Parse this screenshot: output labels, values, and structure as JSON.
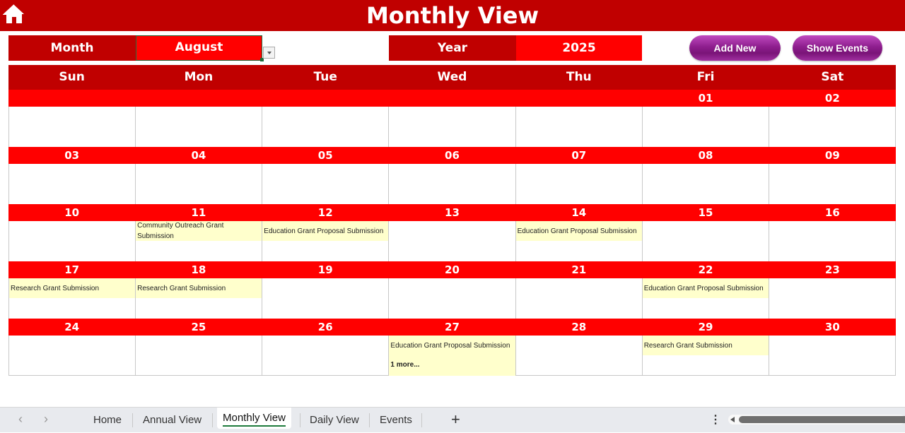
{
  "header": {
    "title": "Monthly View",
    "home_icon": "home-icon"
  },
  "controls": {
    "month_label": "Month",
    "month_value": "August",
    "year_label": "Year",
    "year_value": "2025",
    "add_new_label": "Add New",
    "show_events_label": "Show Events"
  },
  "calendar": {
    "days_of_week": [
      "Sun",
      "Mon",
      "Tue",
      "Wed",
      "Thu",
      "Fri",
      "Sat"
    ],
    "weeks": [
      {
        "dates": [
          "",
          "",
          "",
          "",
          "",
          "01",
          "02"
        ],
        "events": [
          "",
          "",
          "",
          "",
          "",
          "",
          ""
        ],
        "more": [
          "",
          "",
          "",
          "",
          "",
          "",
          ""
        ]
      },
      {
        "dates": [
          "03",
          "04",
          "05",
          "06",
          "07",
          "08",
          "09"
        ],
        "events": [
          "",
          "",
          "",
          "",
          "",
          "",
          ""
        ],
        "more": [
          "",
          "",
          "",
          "",
          "",
          "",
          ""
        ]
      },
      {
        "dates": [
          "10",
          "11",
          "12",
          "13",
          "14",
          "15",
          "16"
        ],
        "events": [
          "",
          "Community Outreach Grant Submission",
          "Education Grant Proposal Submission",
          "",
          "Education Grant Proposal Submission",
          "",
          ""
        ],
        "more": [
          "",
          "",
          "",
          "",
          "",
          "",
          ""
        ]
      },
      {
        "dates": [
          "17",
          "18",
          "19",
          "20",
          "21",
          "22",
          "23"
        ],
        "events": [
          "Research Grant Submission",
          "Research Grant Submission",
          "",
          "",
          "",
          "Education Grant Proposal Submission",
          ""
        ],
        "more": [
          "",
          "",
          "",
          "",
          "",
          "",
          ""
        ]
      },
      {
        "dates": [
          "24",
          "25",
          "26",
          "27",
          "28",
          "29",
          "30"
        ],
        "events": [
          "",
          "",
          "",
          "Education Grant Proposal Submission",
          "",
          "Research Grant Submission",
          ""
        ],
        "more": [
          "",
          "",
          "",
          "1 more...",
          "",
          "",
          ""
        ]
      }
    ]
  },
  "sheet_tabs": {
    "tabs": [
      "Home",
      "Annual View",
      "Monthly View",
      "Daily View",
      "Events"
    ],
    "active": "Monthly View",
    "add_label": "+"
  },
  "colors": {
    "dark_red": "#c00000",
    "red": "#ff0000",
    "event_bg": "#ffffcc",
    "button_purple": "#8e1e8e",
    "active_tab_underline": "#1e7b3c"
  }
}
